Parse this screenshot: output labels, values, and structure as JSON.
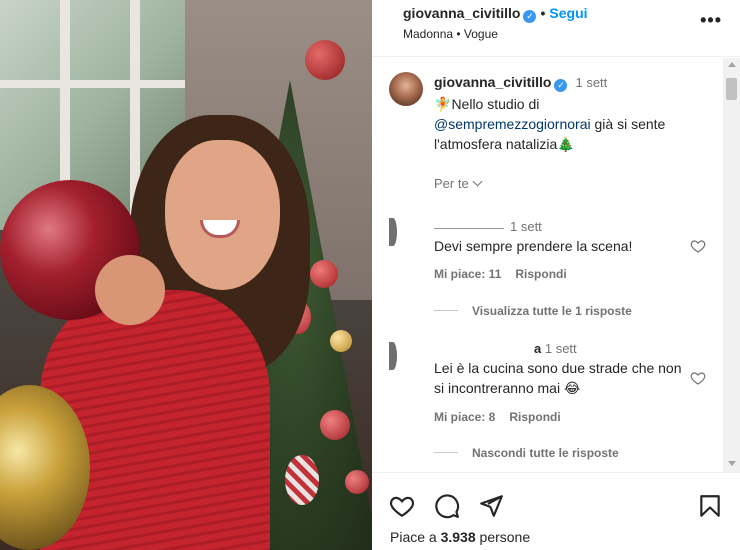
{
  "post": {
    "username": "giovanna_civitillo",
    "follow_label": "Segui",
    "music": "Madonna • Vogue"
  },
  "caption": {
    "username": "giovanna_civitillo",
    "time": "1 sett",
    "prefix_emoji": "🧚",
    "text_before": "Nello studio di",
    "mention": "@sempremezzogiornorai",
    "text_after": "già si sente l'atmosfera natalizia",
    "suffix_emoji": "🎄",
    "translate_label": "Per te"
  },
  "comments": [
    {
      "username": "",
      "time": "1 sett",
      "text": "Devi sempre prendere la scena!",
      "likes_label": "Mi piace: 11",
      "reply_label": "Rispondi",
      "replies_label": "Visualizza tutte le 1 risposte"
    },
    {
      "username": "a",
      "time": "1 sett",
      "text": "Lei è la cucina sono due strade che non si incontreranno mai 😂",
      "likes_label": "Mi piace: 8",
      "reply_label": "Rispondi",
      "replies_label": "Nascondi tutte le risposte"
    }
  ],
  "footer": {
    "likes_prefix": "Piace a",
    "likes_count": "3.938",
    "likes_suffix": "persone"
  },
  "icons": {
    "verified": "verified-badge-icon",
    "more": "more-options-icon",
    "like": "heart-icon",
    "comment": "comment-icon",
    "share": "share-icon",
    "save": "bookmark-icon"
  },
  "colors": {
    "accent": "#0095f6",
    "text": "#262626",
    "muted": "#737373",
    "mention": "#00376b"
  }
}
